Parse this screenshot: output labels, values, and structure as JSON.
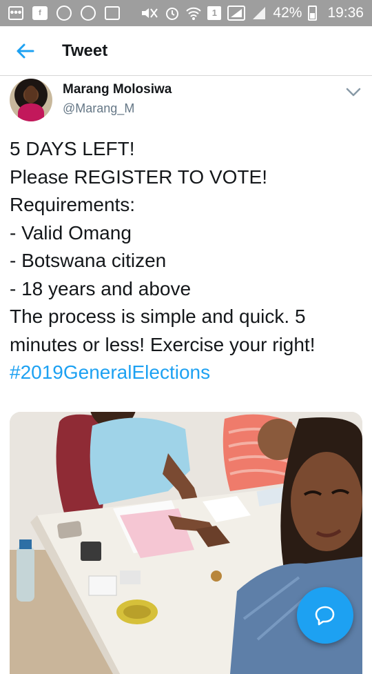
{
  "status_bar": {
    "battery": "42%",
    "time": "19:36",
    "sim_slot": "1"
  },
  "header": {
    "title": "Tweet"
  },
  "tweet": {
    "author_name": "Marang Molosiwa",
    "author_handle": "@Marang_M",
    "lines": [
      "5 DAYS LEFT!",
      "Please REGISTER TO VOTE!",
      "Requirements:",
      "- Valid Omang",
      "- Botswana citizen",
      "- 18 years and above",
      "The process is simple and quick. 5",
      "minutes or less! Exercise your right!"
    ],
    "hashtag": "#2019GeneralElections"
  },
  "colors": {
    "accent": "#1da1f2",
    "status_bar_bg": "#9e9e9e",
    "text_primary": "#14171a",
    "text_secondary": "#657786"
  },
  "icons": {
    "back": "arrow-left",
    "menu": "chevron-down",
    "compose": "reply-bubble"
  }
}
